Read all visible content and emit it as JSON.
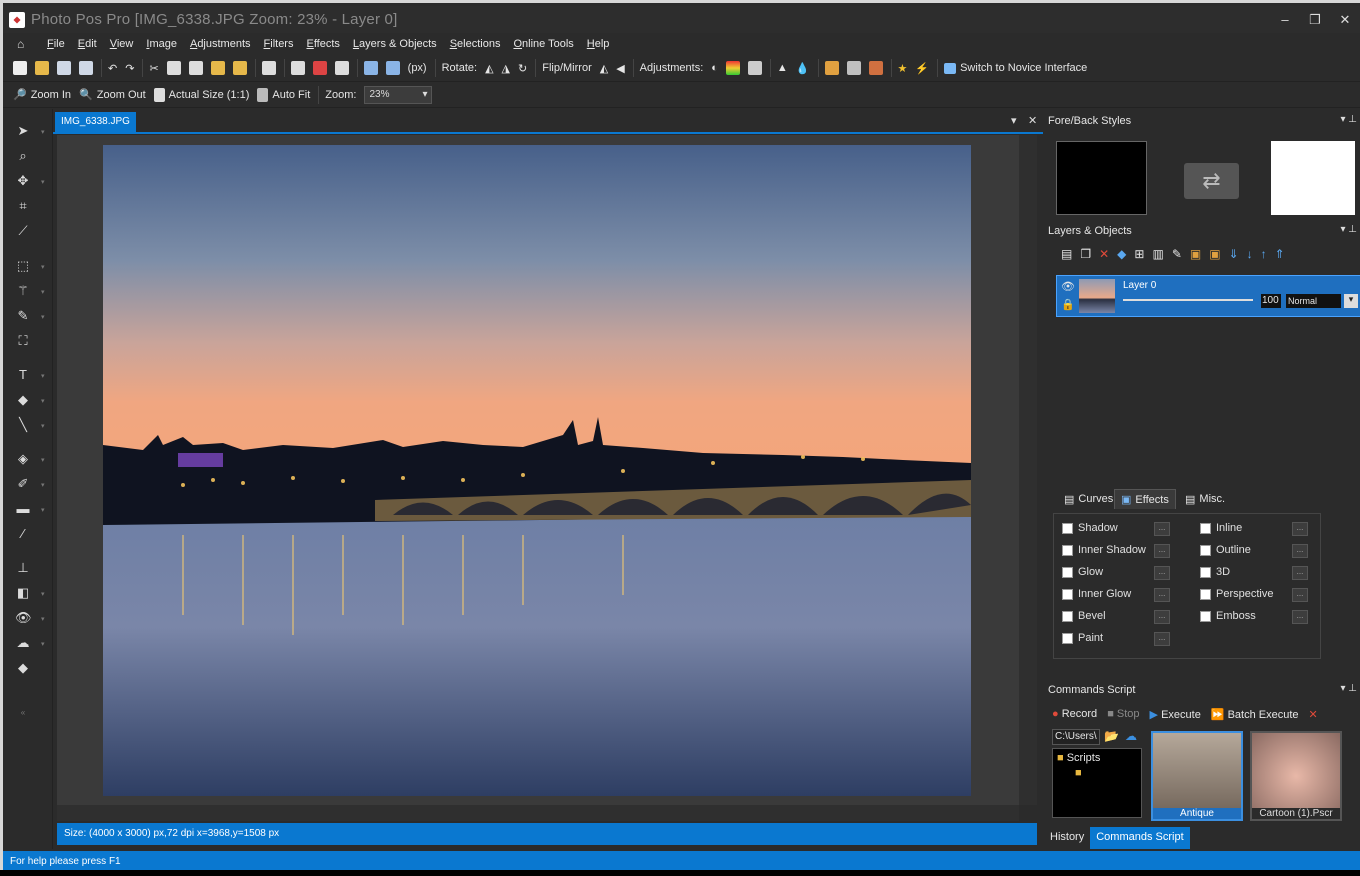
{
  "window": {
    "title": "Photo Pos Pro [IMG_6338.JPG Zoom: 23% - Layer 0]",
    "min_glyph": "‒",
    "restore_glyph": "❐",
    "close_glyph": "✕"
  },
  "menu": [
    "File",
    "Edit",
    "View",
    "Image",
    "Adjustments",
    "Filters",
    "Effects",
    "Layers & Objects",
    "Selections",
    "Online Tools",
    "Help"
  ],
  "toolbar1": {
    "units": "(px)",
    "rotate_label": "Rotate:",
    "flip_label": "Flip/Mirror",
    "adjustments_label": "Adjustments:",
    "switch_label": "Switch to Novice Interface"
  },
  "toolbar2": {
    "zoom_in": "Zoom In",
    "zoom_out": "Zoom Out",
    "actual_size": "Actual Size (1:1)",
    "auto_fit": "Auto Fit",
    "zoom_label": "Zoom:",
    "zoom_value": "23%"
  },
  "document": {
    "tab": "IMG_6338.JPG",
    "status": "Size: (4000 x 3000) px,72 dpi   x=3968,y=1508 px"
  },
  "panels": {
    "foreback": "Fore/Back Styles",
    "layers": "Layers & Objects",
    "layer_name": "Layer 0",
    "opacity": "100",
    "blend": "Normal",
    "tabs": [
      "Curves",
      "Effects",
      "Misc."
    ],
    "effects_left": [
      "Shadow",
      "Inner Shadow",
      "Glow",
      "Inner Glow",
      "Bevel",
      "Paint"
    ],
    "effects_right": [
      "Inline",
      "Outline",
      "3D",
      "Perspective",
      "Emboss"
    ],
    "commands": "Commands Script",
    "record": "Record",
    "stop": "Stop",
    "execute": "Execute",
    "batch": "Batch Execute",
    "path": "C:\\Users\\",
    "folder": "Scripts",
    "thumb1": "Antique",
    "thumb2": "Cartoon (1).Pscr",
    "bottom_tabs": [
      "History",
      "Commands Script"
    ]
  },
  "status": "For help please press F1"
}
